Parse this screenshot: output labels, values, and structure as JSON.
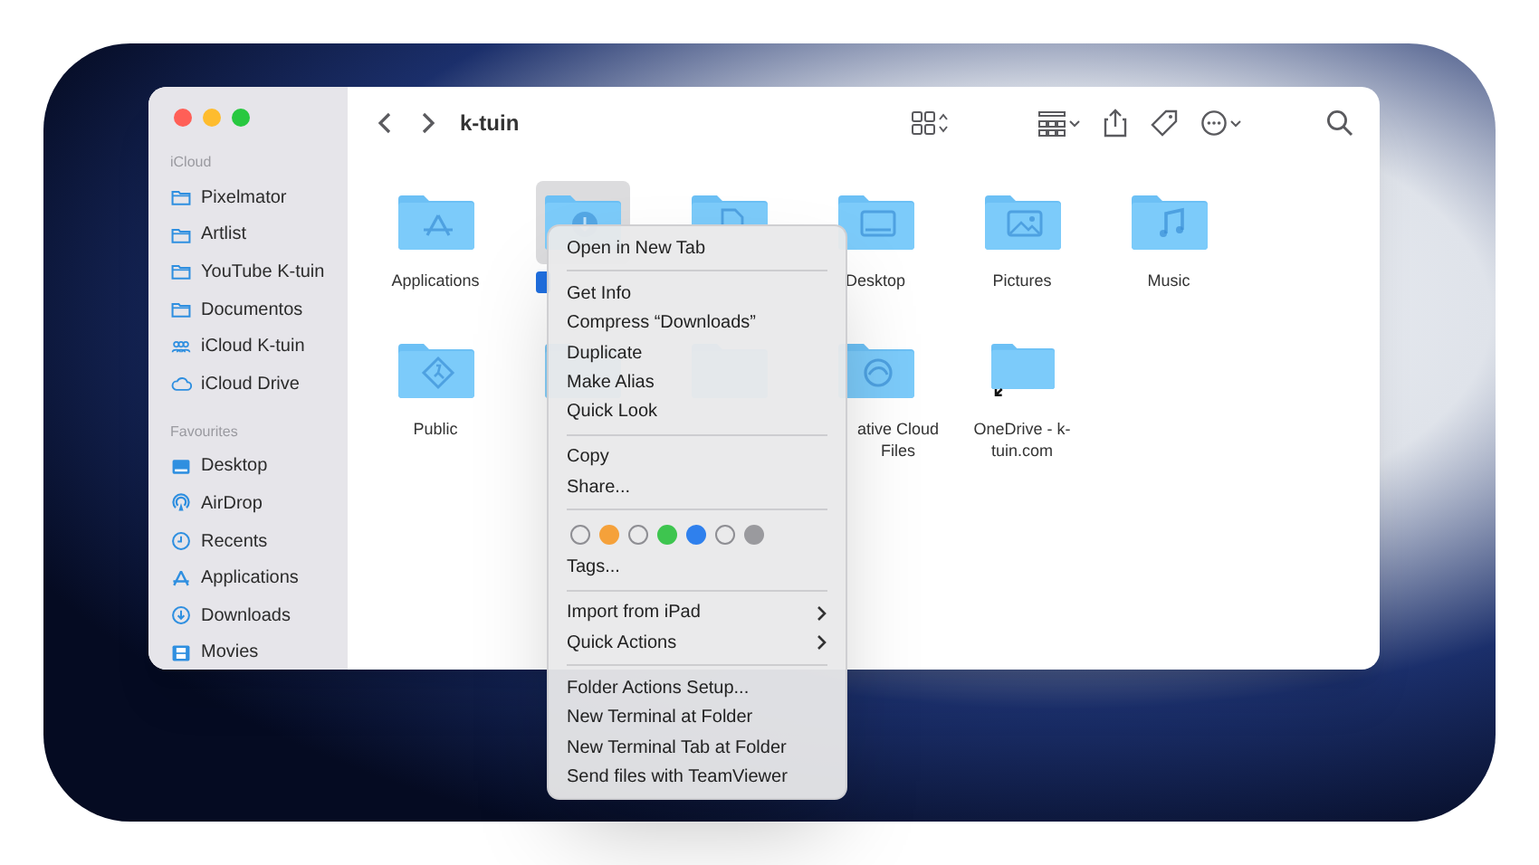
{
  "window": {
    "title": "k-tuin"
  },
  "sidebar": {
    "sections": [
      {
        "heading": "iCloud",
        "items": [
          {
            "label": "Pixelmator"
          },
          {
            "label": "Artlist"
          },
          {
            "label": "YouTube K-tuin"
          },
          {
            "label": "Documentos"
          },
          {
            "label": "iCloud K-tuin"
          },
          {
            "label": "iCloud Drive"
          }
        ]
      },
      {
        "heading": "Favourites",
        "items": [
          {
            "label": "Desktop"
          },
          {
            "label": "AirDrop"
          },
          {
            "label": "Recents"
          },
          {
            "label": "Applications"
          },
          {
            "label": "Downloads"
          },
          {
            "label": "Movies"
          }
        ]
      }
    ]
  },
  "files": [
    {
      "label": "Applications",
      "selected": false
    },
    {
      "selected": true
    },
    {
      "selected": false
    },
    {
      "label": "Desktop",
      "selected": false
    },
    {
      "label": "Pictures",
      "selected": false
    },
    {
      "label": "Music",
      "selected": false
    },
    {
      "label": "Public",
      "selected": false
    },
    {
      "kind": "covered"
    },
    {
      "kind": "covered"
    },
    {
      "label": "ative Cloud Files",
      "selected": false,
      "kind": "cut"
    },
    {
      "label": "OneDrive - k-tuin.com",
      "selected": false
    }
  ],
  "context_menu": {
    "groups": [
      [
        {
          "label": "Open in New Tab"
        }
      ],
      [
        {
          "label": "Get Info"
        },
        {
          "label": "Compress “Downloads”"
        },
        {
          "label": "Duplicate"
        },
        {
          "label": "Make Alias"
        },
        {
          "label": "Quick Look"
        }
      ],
      [
        {
          "label": "Copy"
        },
        {
          "label": "Share..."
        }
      ],
      [
        {
          "kind": "tags",
          "tags": [
            {
              "kind": "hollow"
            },
            {
              "kind": "filled",
              "color": "#f5a13a"
            },
            {
              "kind": "hollow"
            },
            {
              "kind": "filled",
              "color": "#3ec54f"
            },
            {
              "kind": "filled",
              "color": "#2f80ed"
            },
            {
              "kind": "hollow"
            },
            {
              "kind": "filled",
              "color": "#9a9a9e"
            }
          ]
        },
        {
          "label": "Tags..."
        }
      ],
      [
        {
          "label": "Import from iPad",
          "submenu": true
        },
        {
          "label": "Quick Actions",
          "submenu": true
        }
      ],
      [
        {
          "label": "Folder Actions Setup..."
        },
        {
          "label": "New Terminal at Folder"
        },
        {
          "label": "New Terminal Tab at Folder"
        },
        {
          "label": "Send files with TeamViewer"
        }
      ]
    ]
  }
}
